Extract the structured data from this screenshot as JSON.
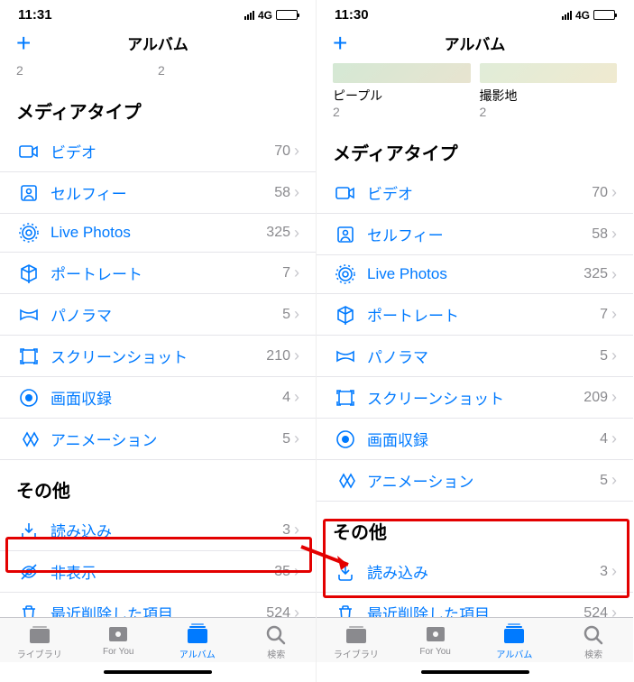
{
  "left": {
    "time": "11:31",
    "network": "4G",
    "title": "アルバム",
    "col1_count": "2",
    "col2_count": "2",
    "section_media": "メディアタイプ",
    "section_other": "その他",
    "media": [
      {
        "icon": "video",
        "label": "ビデオ",
        "count": "70"
      },
      {
        "icon": "selfie",
        "label": "セルフィー",
        "count": "58"
      },
      {
        "icon": "live",
        "label": "Live Photos",
        "count": "325"
      },
      {
        "icon": "portrait",
        "label": "ポートレート",
        "count": "7"
      },
      {
        "icon": "pano",
        "label": "パノラマ",
        "count": "5"
      },
      {
        "icon": "screenshot",
        "label": "スクリーンショット",
        "count": "210"
      },
      {
        "icon": "record",
        "label": "画面収録",
        "count": "4"
      },
      {
        "icon": "anim",
        "label": "アニメーション",
        "count": "5"
      }
    ],
    "other": [
      {
        "icon": "import",
        "label": "読み込み",
        "count": "3"
      },
      {
        "icon": "hidden",
        "label": "非表示",
        "count": "35"
      },
      {
        "icon": "trash",
        "label": "最近削除した項目",
        "count": "524"
      }
    ]
  },
  "right": {
    "time": "11:30",
    "network": "4G",
    "title": "アルバム",
    "col1_label": "ピープル",
    "col1_count": "2",
    "col2_label": "撮影地",
    "col2_count": "2",
    "section_media": "メディアタイプ",
    "section_other": "その他",
    "media": [
      {
        "icon": "video",
        "label": "ビデオ",
        "count": "70"
      },
      {
        "icon": "selfie",
        "label": "セルフィー",
        "count": "58"
      },
      {
        "icon": "live",
        "label": "Live Photos",
        "count": "325"
      },
      {
        "icon": "portrait",
        "label": "ポートレート",
        "count": "7"
      },
      {
        "icon": "pano",
        "label": "パノラマ",
        "count": "5"
      },
      {
        "icon": "screenshot",
        "label": "スクリーンショット",
        "count": "209"
      },
      {
        "icon": "record",
        "label": "画面収録",
        "count": "4"
      },
      {
        "icon": "anim",
        "label": "アニメーション",
        "count": "5"
      }
    ],
    "other": [
      {
        "icon": "import",
        "label": "読み込み",
        "count": "3"
      },
      {
        "icon": "trash",
        "label": "最近削除した項目",
        "count": "524"
      }
    ]
  },
  "tabs": [
    {
      "id": "library",
      "label": "ライブラリ"
    },
    {
      "id": "foryou",
      "label": "For You"
    },
    {
      "id": "albums",
      "label": "アルバム"
    },
    {
      "id": "search",
      "label": "検索"
    }
  ]
}
